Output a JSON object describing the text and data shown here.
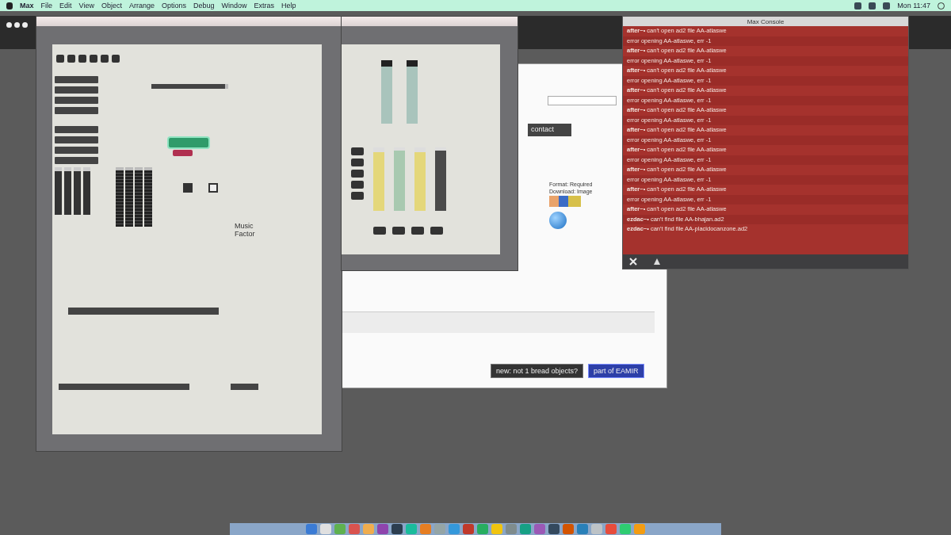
{
  "menu_bar": {
    "items": [
      "Max",
      "File",
      "Edit",
      "View",
      "Object",
      "Arrange",
      "Options",
      "Debug",
      "Window",
      "Extras",
      "Help"
    ],
    "clock": "Mon 11:47"
  },
  "left_patcher": {
    "comment": "Music Factor",
    "h_slider": {
      "level": 0.96
    },
    "sliders": [
      {
        "level": 0.92
      },
      {
        "level": 0.92
      },
      {
        "level": 0.92
      },
      {
        "level": 0.92
      }
    ],
    "meters": [
      {
        "level": 0.95
      },
      {
        "level": 0.95
      },
      {
        "level": 0.95
      },
      {
        "level": 0.95
      }
    ],
    "toggles": [
      {
        "checked": true
      },
      {
        "checked": false
      }
    ]
  },
  "middle_patcher": {
    "meters": [
      {
        "level": 0.9,
        "color": "#a9c4bc"
      },
      {
        "level": 0.9,
        "color": "#a9c4bc"
      }
    ],
    "sliders": [
      {
        "level": 0.92,
        "color": "#e4d77a"
      },
      {
        "level": 0.95,
        "color": "#a8c9b0"
      },
      {
        "level": 0.92,
        "color": "#e4d77a"
      },
      {
        "level": 0.95,
        "color": "#4a4a4a"
      }
    ]
  },
  "web_page": {
    "field": "contact",
    "info": [
      "Format: Required",
      "Download: Image"
    ],
    "buttons": [
      {
        "label": "new: not 1 bread objects?",
        "selected": false
      },
      {
        "label": "part of EAMIR",
        "selected": true
      }
    ]
  },
  "console": {
    "title": "Max Console",
    "lines": [
      {
        "source": "after~",
        "text": "• can't open ad2 file AA-atlaswe"
      },
      {
        "text": "error opening AA-atlaswe, err -1"
      },
      {
        "source": "after~",
        "text": "• can't open ad2 file AA-atlaswe"
      },
      {
        "text": "error opening AA-atlaswe, err -1"
      },
      {
        "source": "after~",
        "text": "• can't open ad2 file AA-atlaswe"
      },
      {
        "text": "error opening AA-atlaswe, err -1"
      },
      {
        "source": "after~",
        "text": "• can't open ad2 file AA-atlaswe"
      },
      {
        "text": "error opening AA-atlaswe, err -1"
      },
      {
        "source": "after~",
        "text": "• can't open ad2 file AA-atlaswe"
      },
      {
        "text": "error opening AA-atlaswe, err -1"
      },
      {
        "source": "after~",
        "text": "• can't open ad2 file AA-atlaswe"
      },
      {
        "text": "error opening AA-atlaswe, err -1"
      },
      {
        "source": "after~",
        "text": "• can't open ad2 file AA-atlaswe"
      },
      {
        "text": "error opening AA-atlaswe, err -1"
      },
      {
        "source": "after~",
        "text": "• can't open ad2 file AA-atlaswe"
      },
      {
        "text": "error opening AA-atlaswe, err -1"
      },
      {
        "source": "after~",
        "text": "• can't open ad2 file AA-atlaswe"
      },
      {
        "text": "error opening AA-atlaswe, err -1"
      },
      {
        "source": "after~",
        "text": "• can't open ad2 file AA-atlaswe"
      },
      {
        "source": "ezdac~",
        "text": "• can't find file AA-bhajan.ad2"
      },
      {
        "source": "ezdac~",
        "text": "• can't find file AA-placidocanzone.ad2"
      }
    ]
  }
}
